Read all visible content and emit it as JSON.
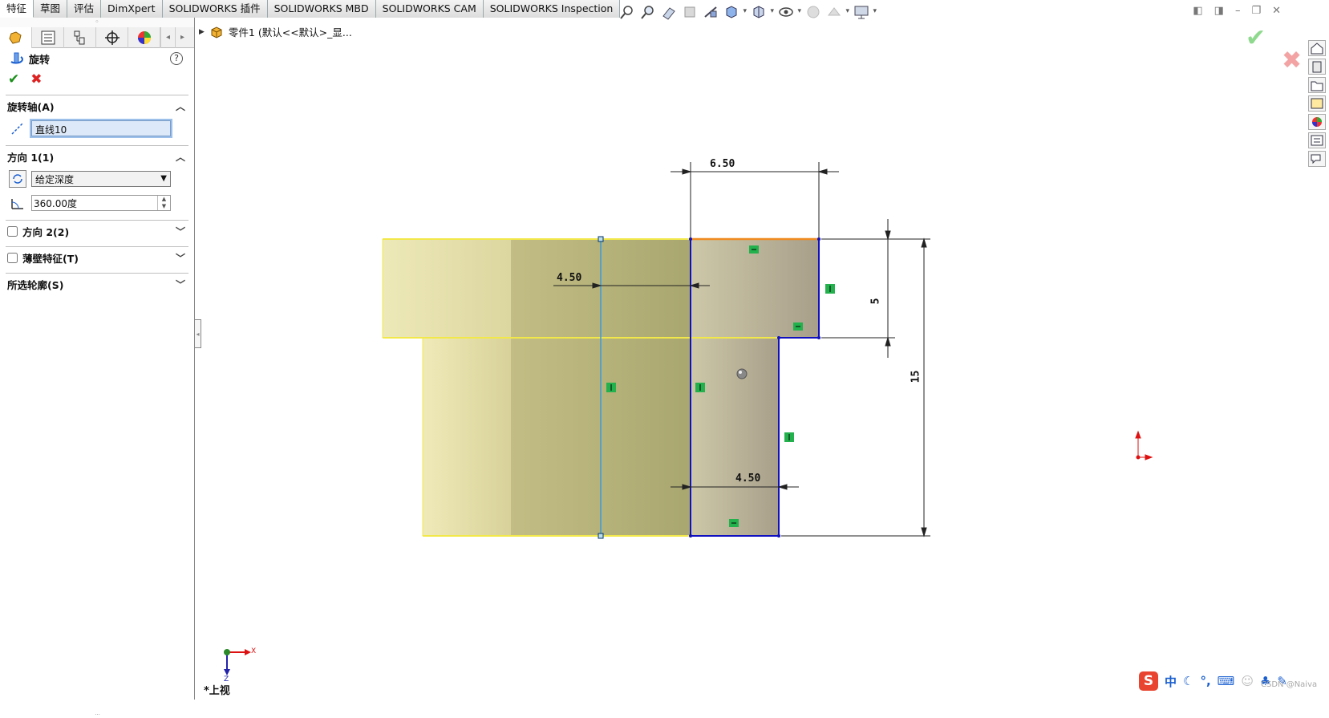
{
  "tabs": [
    "特征",
    "草图",
    "评估",
    "DimXpert",
    "SOLIDWORKS 插件",
    "SOLIDWORKS MBD",
    "SOLIDWORKS CAM",
    "SOLIDWORKS Inspection"
  ],
  "feature": {
    "title": "旋转",
    "help": "?",
    "ok": "✔",
    "cancel": "✖"
  },
  "axis_section": {
    "title": "旋转轴(A)",
    "value": "直线10"
  },
  "dir1_section": {
    "title": "方向 1(1)",
    "end_condition": "给定深度",
    "angle": "360.00度"
  },
  "dir2_section": {
    "title": "方向 2(2)"
  },
  "thin_section": {
    "title": "薄壁特征(T)"
  },
  "contours_section": {
    "title": "所选轮廓(S)"
  },
  "tree": {
    "label": "零件1  (默认<<默认>_显..."
  },
  "dimensions": {
    "top_width": "6.50",
    "left_offset": "4.50",
    "bottom_width": "4.50",
    "step_height": "5",
    "total_height": "15"
  },
  "triad": {
    "x": "X",
    "z": "Z"
  },
  "view_label": "*上视",
  "ime": {
    "logo": "S",
    "mode": "中",
    "extra": "°,"
  },
  "watermark": "CSDN @Naiva",
  "colors": {
    "accent_blue": "#1a3bd6",
    "sketch_blue": "#1010c0",
    "highlight_yellow": "#f2e84a",
    "selected_orange": "#f08a20",
    "relation_green": "#22b14c",
    "ok_green": "#1a8f1a",
    "cancel_red": "#d22"
  }
}
